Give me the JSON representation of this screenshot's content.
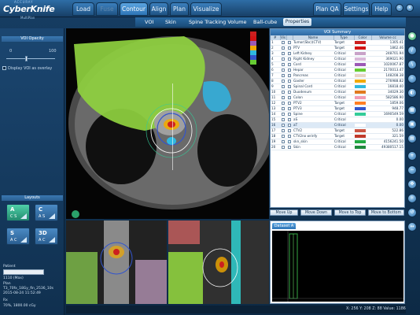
{
  "app": {
    "logo_top": "ACCURAY",
    "logo_name": "CyberKnife",
    "logo_sub": "MultiPlan"
  },
  "tabs": [
    {
      "label": "Load"
    },
    {
      "label": "Fuse"
    },
    {
      "label": "Contour"
    },
    {
      "label": "Align"
    },
    {
      "label": "Plan"
    },
    {
      "label": "Visualize"
    }
  ],
  "right_tabs": [
    {
      "label": "Plan QA"
    },
    {
      "label": "Settings"
    },
    {
      "label": "Help"
    }
  ],
  "subtabs": [
    {
      "label": "VOI"
    },
    {
      "label": "Skin"
    },
    {
      "label": "Spine Tracking Volume"
    },
    {
      "label": "Ball-cube"
    },
    {
      "label": "Properties"
    }
  ],
  "left": {
    "voi_opacity_title": "VOI Opacity",
    "slider_min": "0",
    "slider_max": "100",
    "slider_value_fraction": 0.42,
    "overlay_label": "Display VOI as overlay",
    "layouts_title": "Layouts",
    "layouts": [
      {
        "big": "A",
        "small": "C  S"
      },
      {
        "big": "C",
        "small": "A  S"
      },
      {
        "big": "S",
        "small": "A  C"
      },
      {
        "big": "3D",
        "small": "A  C"
      }
    ],
    "patient_label": "Patient",
    "patient_info": "1110 (Max)",
    "plan_label": "Plan",
    "plan_line1": "T3_70fx_18Gy_fin_2536_10s",
    "plan_line2": "2015-08-24 11:52:49",
    "rx_label": "Rx",
    "rx_line": "70%, 1800.00 cGy"
  },
  "voi_summary": {
    "title": "VOI Summary",
    "columns": [
      "#",
      "Vis",
      "",
      "Name",
      "Type",
      "Color",
      "Volume cc"
    ],
    "rows": [
      {
        "num": "1",
        "name": "Tumor(Sbc)(CTV)",
        "type": "Target",
        "color": "#cc1f1f",
        "volume": "1305.41"
      },
      {
        "num": "2",
        "name": "PTV",
        "type": "Target",
        "color": "#d21414",
        "volume": "1862.46"
      },
      {
        "num": "3",
        "name": "Left Kidney",
        "type": "Critical",
        "color": "#c8a2c8",
        "volume": "248701.94"
      },
      {
        "num": "4",
        "name": "Right Kidney",
        "type": "Critical",
        "color": "#d9b8d9",
        "volume": "369021.90"
      },
      {
        "num": "5",
        "name": "Cord",
        "type": "Critical",
        "color": "#9b59b6",
        "volume": "1020067.87"
      },
      {
        "num": "6",
        "name": "Hepar",
        "type": "Critical",
        "color": "#66cc33",
        "volume": "2170013.47"
      },
      {
        "num": "7",
        "name": "Pancreas",
        "type": "Critical",
        "color": "#e8d3c6",
        "volume": "148208.38"
      },
      {
        "num": "8",
        "name": "Gaster",
        "type": "Critical",
        "color": "#f2a900",
        "volume": "276988.82"
      },
      {
        "num": "9",
        "name": "Spinal Cord",
        "type": "Critical",
        "color": "#2fb8e0",
        "volume": "16818.40"
      },
      {
        "num": "10",
        "name": "Duodenum",
        "type": "Critical",
        "color": "#e07a1f",
        "volume": "34029.30"
      },
      {
        "num": "11",
        "name": "Colon",
        "type": "Critical",
        "color": "#f19bb5",
        "volume": "582586.90"
      },
      {
        "num": "12",
        "name": "PTV2",
        "type": "Target",
        "color": "#ff7f24",
        "volume": "1859.06"
      },
      {
        "num": "13",
        "name": "PTV3",
        "type": "Target",
        "color": "#3355cc",
        "volume": "948.77"
      },
      {
        "num": "14",
        "name": "Spine",
        "type": "Critical",
        "color": "#33cc99",
        "volume": "1690549.59"
      },
      {
        "num": "15",
        "name": "aS",
        "type": "Critical",
        "color": "#ffffff",
        "volume": "0.00"
      },
      {
        "num": "16",
        "name": "aT",
        "type": "Critical",
        "color": "#ffffff",
        "volume": "0.00"
      },
      {
        "num": "17",
        "name": "CTV2",
        "type": "Target",
        "color": "#cc5544",
        "volume": "522.86"
      },
      {
        "num": "18",
        "name": "CTV2no wrinfy",
        "type": "Target",
        "color": "#c03a2b",
        "volume": "321.59"
      },
      {
        "num": "19",
        "name": "skn_skin",
        "type": "Critical",
        "color": "#22aa44",
        "volume": "4156241.50"
      },
      {
        "num": "20",
        "name": "Skin",
        "type": "Critical",
        "color": "#1f8a3d",
        "volume": "49380517.15"
      }
    ]
  },
  "voi_buttons": [
    {
      "label": "Move Up"
    },
    {
      "label": "Move Down"
    },
    {
      "label": "Move to Top"
    },
    {
      "label": "Move to Bottom"
    }
  ],
  "dataset": {
    "tab_label": "Dataset A"
  },
  "status": {
    "text": "X: 256  Y: 208  Z: 88  Value: 1186"
  },
  "colors": {
    "accent": "#2d74b6",
    "active_tab": "#5aa4e0",
    "liver": "#66cc33",
    "spine_blue": "#2fb8e0"
  }
}
